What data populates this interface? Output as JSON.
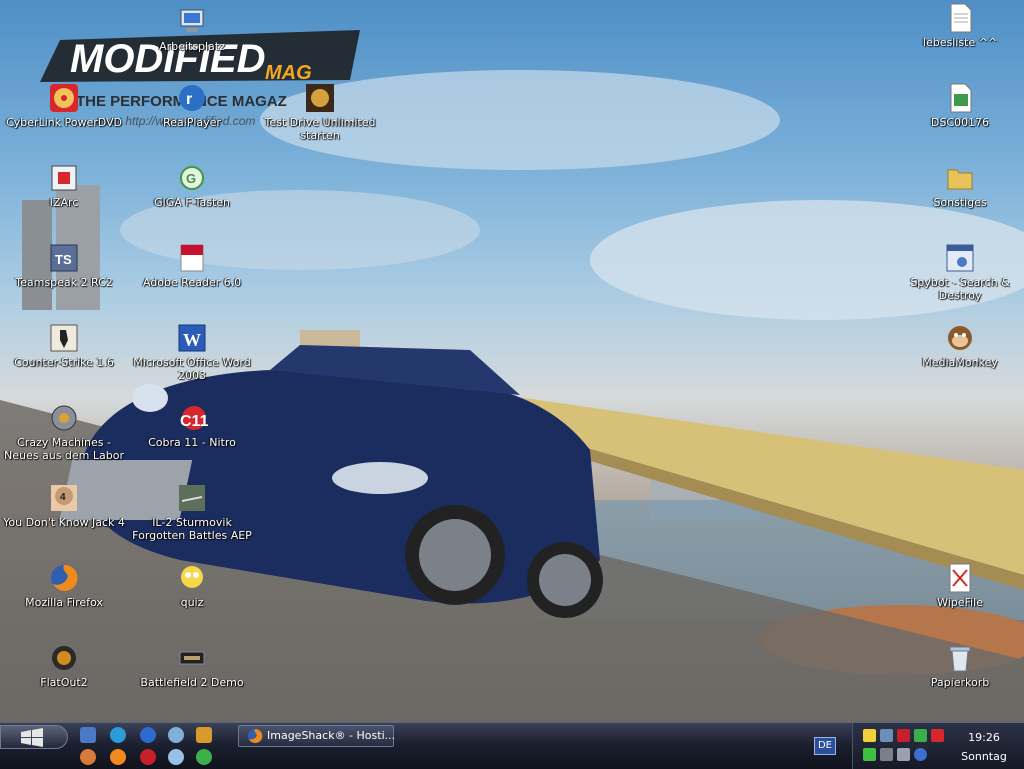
{
  "wallpaper": {
    "logo_main": "MODIFIED",
    "logo_sub": "MAG",
    "tagline": "THE PERFORMANCE MAGAZ",
    "url_text": "us at http://www.modified.com",
    "colors": {
      "sky": "#79afd8",
      "car": "#1b2c5e",
      "bridge": "#d7c178",
      "logo_red": "#d4202a",
      "logo_orange": "#f5a623"
    }
  },
  "desktop_icons": [
    {
      "label": "Arbeitsplatz",
      "icon": "computer-icon"
    },
    {
      "label": "CyberLink PowerDVD",
      "icon": "powerdvd-icon"
    },
    {
      "label": "RealPlayer",
      "icon": "realplayer-icon"
    },
    {
      "label": "Test Drive Unlimited starten",
      "icon": "testdrive-icon"
    },
    {
      "label": "IZArc",
      "icon": "izarc-icon"
    },
    {
      "label": "GIGA F-Tasten",
      "icon": "giga-icon"
    },
    {
      "label": "Teamspeak 2 RC2",
      "icon": "teamspeak-icon"
    },
    {
      "label": "Adobe Reader 6.0",
      "icon": "adobe-reader-icon"
    },
    {
      "label": "Counter-Strike 1.6",
      "icon": "counter-strike-icon"
    },
    {
      "label": "Microsoft Office Word 2003",
      "icon": "word-icon"
    },
    {
      "label": "Crazy Machines - Neues aus dem Labor",
      "icon": "crazy-machines-icon"
    },
    {
      "label": "Cobra 11 - Nitro",
      "icon": "cobra11-icon"
    },
    {
      "label": "You Don't Know Jack 4",
      "icon": "ydkj-icon"
    },
    {
      "label": "IL-2 Sturmovik Forgotten Battles AEP",
      "icon": "il2-icon"
    },
    {
      "label": "Mozilla Firefox",
      "icon": "firefox-icon"
    },
    {
      "label": "quiz",
      "icon": "homer-icon"
    },
    {
      "label": "FlatOut2",
      "icon": "flatout-icon"
    },
    {
      "label": "Battlefield 2 Demo",
      "icon": "battlefield-icon"
    },
    {
      "label": "lebesliste ^^",
      "icon": "text-document-icon"
    },
    {
      "label": "DSC00176",
      "icon": "image-file-icon"
    },
    {
      "label": "Sonstiges",
      "icon": "folder-icon"
    },
    {
      "label": "Spybot - Search & Destroy",
      "icon": "spybot-icon"
    },
    {
      "label": "MediaMonkey",
      "icon": "mediamonkey-icon"
    },
    {
      "label": "WipeFile",
      "icon": "wipefile-icon"
    },
    {
      "label": "Papierkorb",
      "icon": "recycle-bin-icon"
    }
  ],
  "taskbar": {
    "quick_launch": [
      "show-desktop-icon",
      "messenger-icon",
      "ie-icon",
      "winamp-icon",
      "launcher-icon",
      "games-icon",
      "firefox-icon",
      "opera-icon",
      "chat-icon",
      "globe-icon"
    ],
    "active_window": {
      "label": "ImageShack® - Hosti...",
      "icon": "firefox-icon"
    },
    "language": "DE",
    "clock_time": "19:26",
    "clock_day": "Sonntag"
  }
}
